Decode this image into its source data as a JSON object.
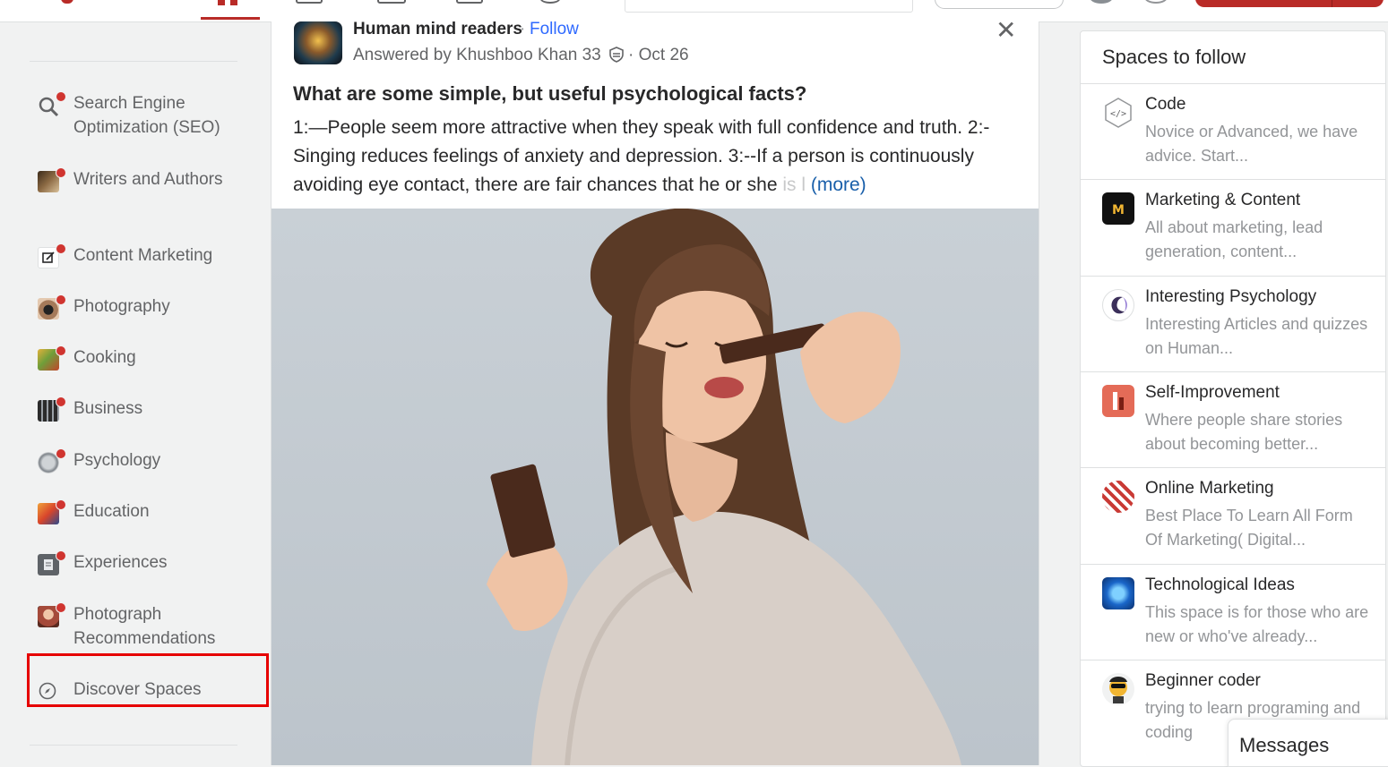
{
  "sidebar": {
    "items": [
      {
        "label": "Search Engine Optimization (SEO)",
        "icon": "seo-magnifier-icon",
        "color": "#7a7a7a"
      },
      {
        "label": "Writers and Authors",
        "icon": "writers-icon",
        "color": "#6b4e2e"
      },
      {
        "label": "Content Marketing",
        "icon": "content-edit-icon",
        "color": "#ffffff"
      },
      {
        "label": "Photography",
        "icon": "camera-icon",
        "color": "#5a4a3c"
      },
      {
        "label": "Cooking",
        "icon": "food-icon",
        "color": "#c99c2e"
      },
      {
        "label": "Business",
        "icon": "business-people-icon",
        "color": "#3b3b3b"
      },
      {
        "label": "Psychology",
        "icon": "brain-icon",
        "color": "#9aa0a6"
      },
      {
        "label": "Education",
        "icon": "education-icon",
        "color": "#e06b2c"
      },
      {
        "label": "Experiences",
        "icon": "notebook-icon",
        "color": "#5f6368"
      },
      {
        "label": "Photograph Recommendations",
        "icon": "portrait-icon",
        "color": "#a54a3a"
      }
    ],
    "discover_label": "Discover Spaces"
  },
  "post": {
    "space_name": "Human mind readers",
    "follow_label": "Follow",
    "answered_by": "Answered by Khushboo Khan 33",
    "date": "Oct 26",
    "question": "What are some simple, but useful psychological facts?",
    "answer_main": "1:—People seem more attractive when they speak with full confidence and truth. 2:-Singing reduces feelings of anxiety and depression. 3:--If a person is continuously avoiding eye contact, there are fair chances that he or she",
    "answer_fade": " is l",
    "more_label": "(more)",
    "close_symbol": "✕"
  },
  "spaces_panel": {
    "title": "Spaces to follow",
    "items": [
      {
        "name": "Code",
        "desc": "Novice or Advanced, we have advice. Start...",
        "icon": "code-brackets-icon"
      },
      {
        "name": "Marketing & Content",
        "desc": "All about marketing, lead generation, content...",
        "icon": "marketing-m-icon"
      },
      {
        "name": "Interesting Psychology",
        "desc": "Interesting Articles and quizzes on Human...",
        "icon": "psychology-swirl-icon"
      },
      {
        "name": "Self-Improvement",
        "desc": "Where people share stories about becoming better...",
        "icon": "self-improvement-icon"
      },
      {
        "name": "Online Marketing",
        "desc": "Best Place To Learn All Form Of Marketing( Digital...",
        "icon": "online-marketing-icon"
      },
      {
        "name": "Technological Ideas",
        "desc": "This space is for those who are new or who've already...",
        "icon": "circuit-chip-icon"
      },
      {
        "name": "Beginner coder",
        "desc": "trying to learn programing and coding",
        "icon": "coder-avatar-icon"
      }
    ]
  },
  "messages_label": "Messages",
  "colors": {
    "brand_red": "#b92b27",
    "link_blue": "#2e69ff",
    "more_blue": "#195faa",
    "highlight_box": "#e60000",
    "notification_dot": "#d03530"
  }
}
